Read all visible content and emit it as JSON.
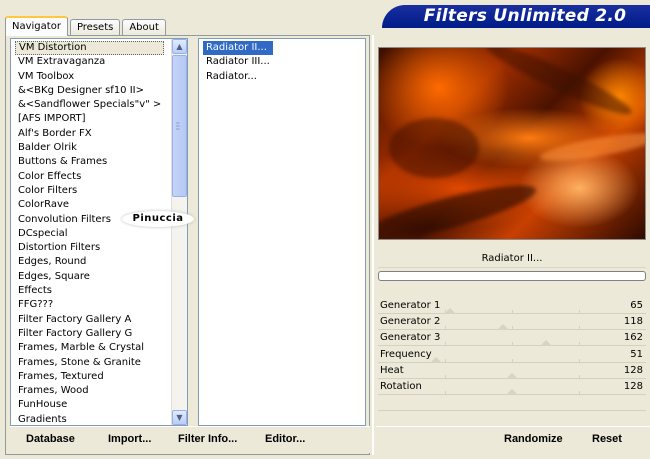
{
  "tabs": [
    {
      "label": "Navigator",
      "active": true
    },
    {
      "label": "Presets",
      "active": false
    },
    {
      "label": "About",
      "active": false
    }
  ],
  "title": "Filters Unlimited 2.0",
  "watermark": "Pinuccia",
  "categories": [
    "VM Distortion",
    "VM Extravaganza",
    "VM Toolbox",
    "&<BKg Designer sf10 II>",
    "&<Sandflower Specials\"v\" >",
    "[AFS IMPORT]",
    "Alf's Border FX",
    "Balder Olrik",
    "Buttons & Frames",
    "Color Effects",
    "Color Filters",
    "ColorRave",
    "Convolution Filters",
    "DCspecial",
    "Distortion Filters",
    "Edges, Round",
    "Edges, Square",
    "Effects",
    "FFG???",
    "Filter Factory Gallery A",
    "Filter Factory Gallery G",
    "Frames, Marble & Crystal",
    "Frames, Stone & Granite",
    "Frames, Textured",
    "Frames, Wood",
    "FunHouse",
    "Gradients"
  ],
  "selected_category": "VM Distortion",
  "filters": [
    "Radiator II...",
    "Radiator III...",
    "Radiator..."
  ],
  "selected_filter": "Radiator II...",
  "preview_label": "Radiator II...",
  "parameters": [
    {
      "label": "Generator 1",
      "value": "65",
      "level": 65
    },
    {
      "label": "Generator 2",
      "value": "118",
      "level": 118
    },
    {
      "label": "Generator 3",
      "value": "162",
      "level": 162
    },
    {
      "label": "Frequency",
      "value": "51",
      "level": 51
    },
    {
      "label": "Heat",
      "value": "128",
      "level": 128
    },
    {
      "label": "Rotation",
      "value": "128",
      "level": 128
    }
  ],
  "param_max": 255,
  "buttons": {
    "database": "Database",
    "import": "Import...",
    "filter_info": "Filter Info...",
    "editor": "Editor...",
    "randomize": "Randomize",
    "reset": "Reset"
  },
  "colors": {
    "title_bg": "#001c88",
    "selection": "#316ac5",
    "preview_orange": "#ff6a00"
  }
}
